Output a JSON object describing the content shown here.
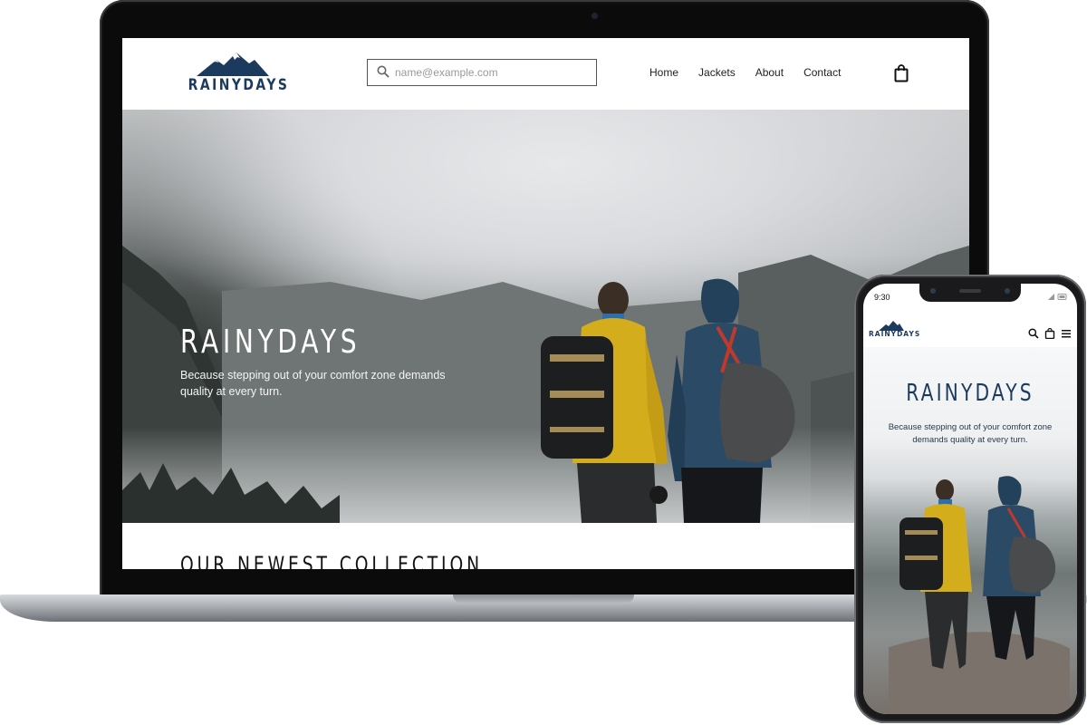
{
  "brand": {
    "name": "RAINYDAYS",
    "primary_color": "#1c3a5e"
  },
  "desktop": {
    "search": {
      "placeholder": "name@example.com",
      "icon": "search-icon"
    },
    "nav": {
      "items": [
        {
          "label": "Home"
        },
        {
          "label": "Jackets"
        },
        {
          "label": "About"
        },
        {
          "label": "Contact"
        }
      ],
      "cart_icon": "shopping-bag-icon"
    },
    "hero": {
      "title": "RAINYDAYS",
      "tagline": "Because stepping out of your comfort zone demands quality at every turn."
    },
    "section": {
      "title": "OUR NEWEST COLLECTION"
    }
  },
  "mobile": {
    "status": {
      "time": "9:30"
    },
    "header": {
      "icons": [
        "search-icon",
        "shopping-bag-icon",
        "menu-icon"
      ]
    },
    "hero": {
      "title": "RAINYDAYS",
      "tagline": "Because stepping out of your comfort zone demands quality at every turn."
    }
  }
}
